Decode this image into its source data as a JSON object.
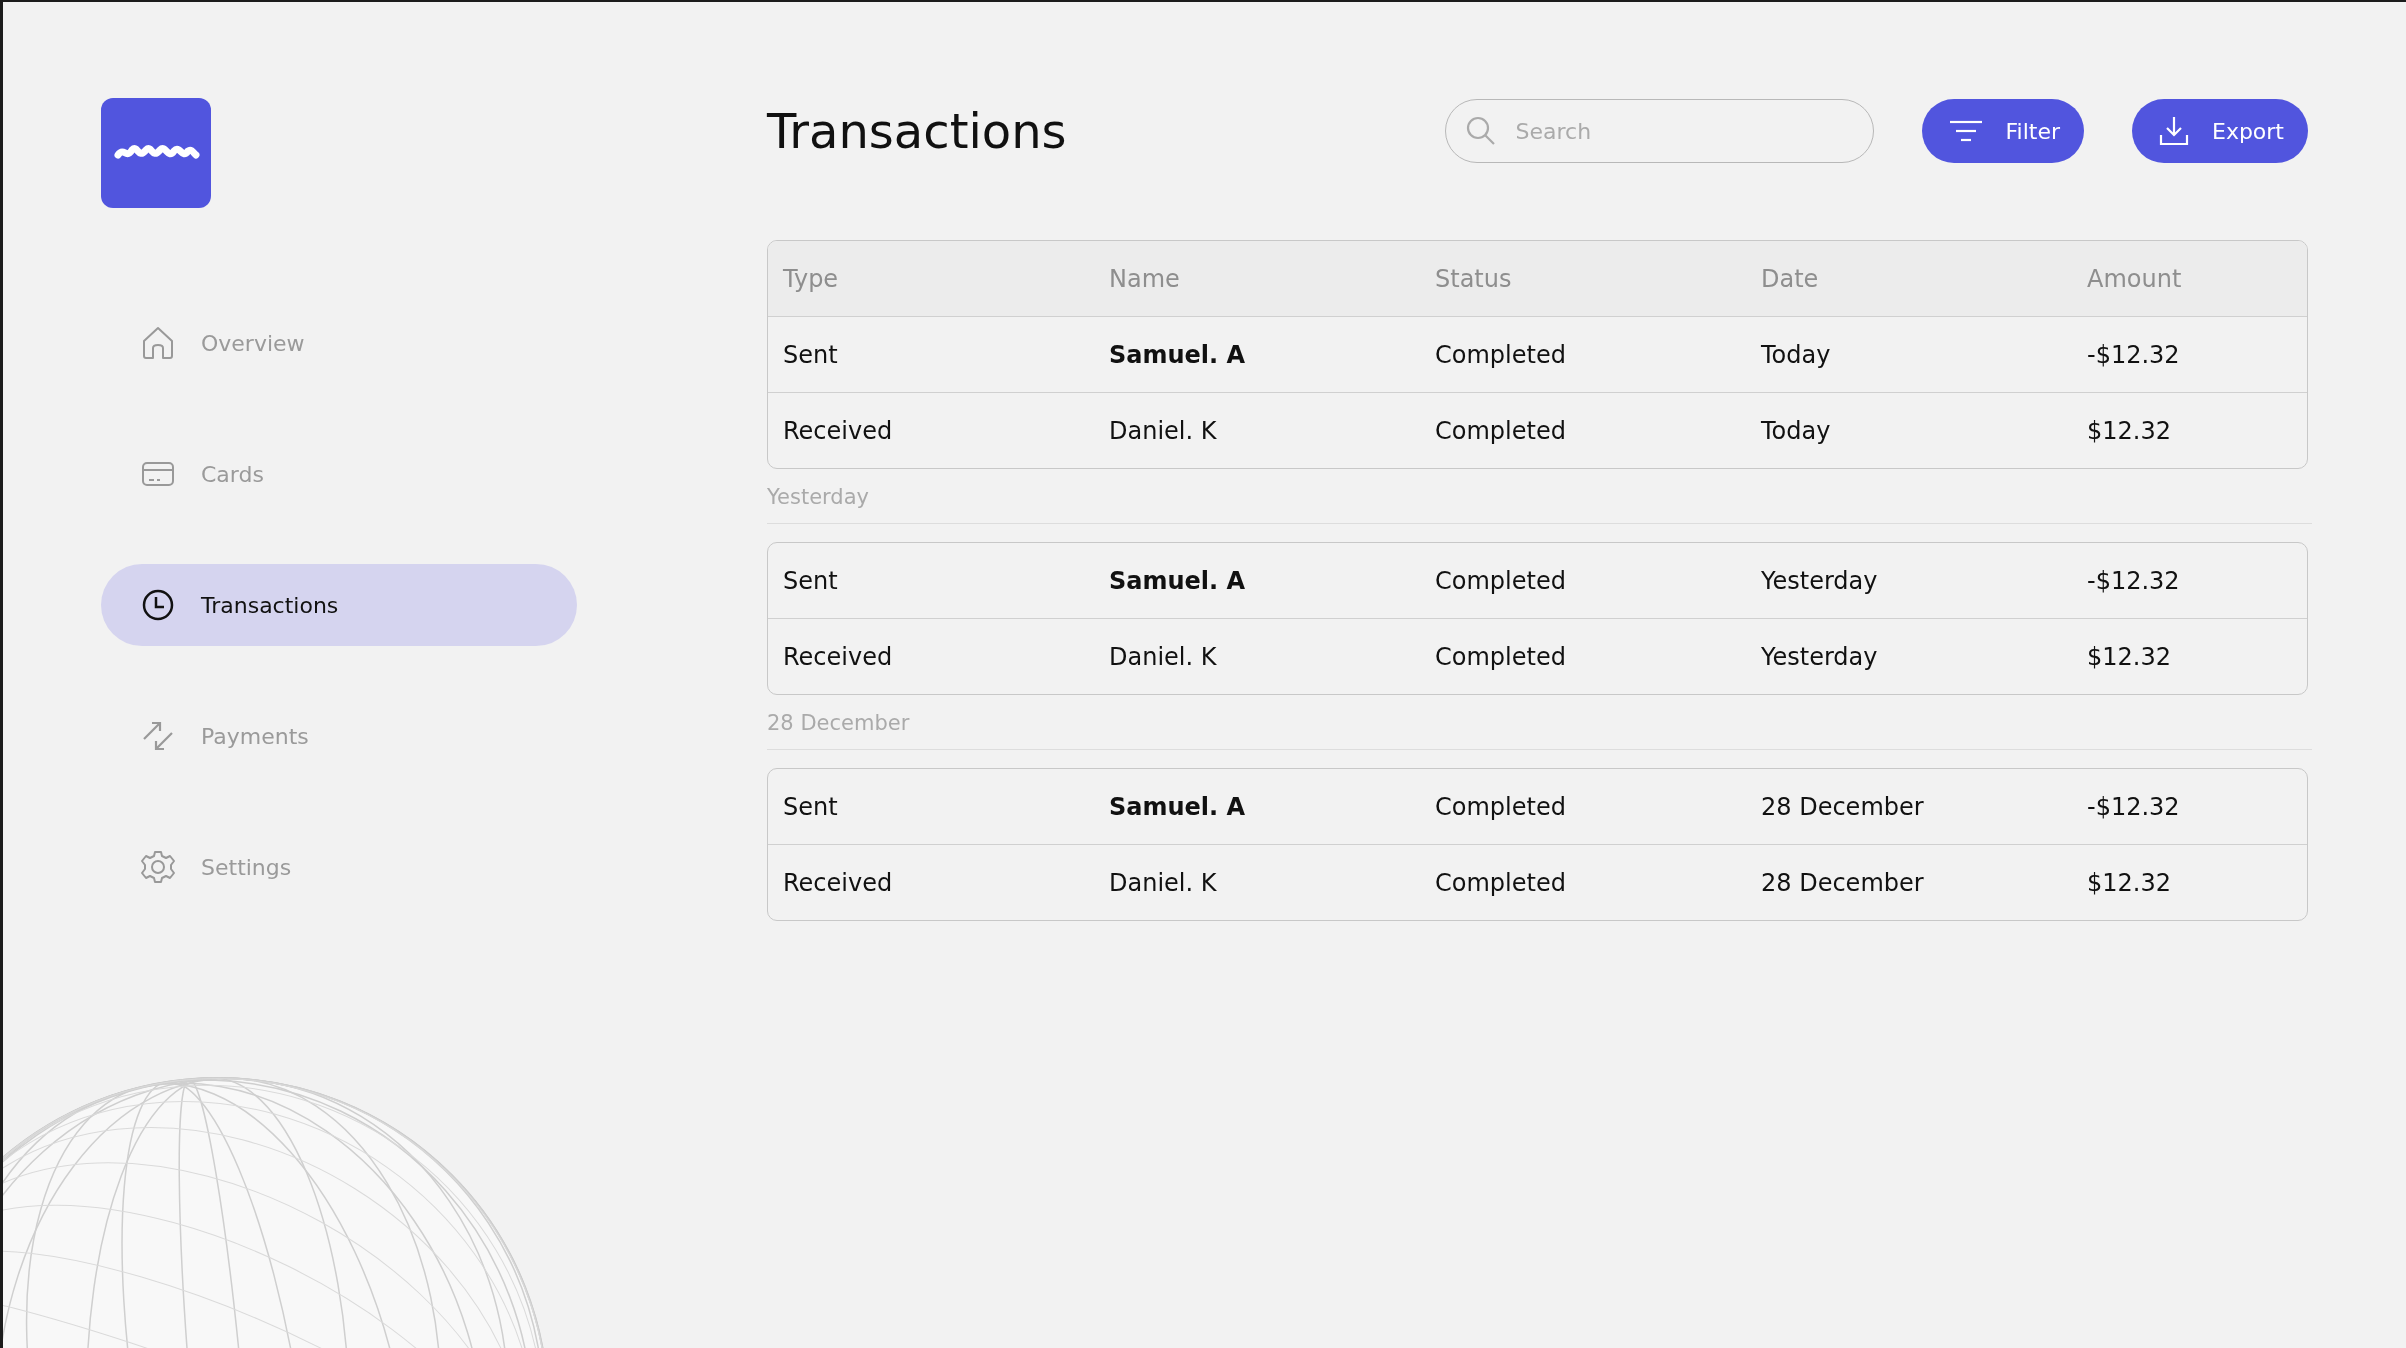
{
  "nav": [
    {
      "label": "Overview",
      "selected": false
    },
    {
      "label": "Cards",
      "selected": false
    },
    {
      "label": "Transactions",
      "selected": true
    },
    {
      "label": "Payments",
      "selected": false
    },
    {
      "label": "Settings",
      "selected": false
    }
  ],
  "header": {
    "title": "Transactions",
    "search": {
      "placeholder": "Search"
    },
    "buttons": [
      {
        "label": "Filter"
      },
      {
        "label": "Export"
      }
    ]
  },
  "table": {
    "columns": [
      "Type",
      "Name",
      "Status",
      "Date",
      "Amount"
    ],
    "groups": [
      {
        "rows": [
          {
            "type": "Sent",
            "name": "Samuel. A",
            "name_bold": true,
            "status": "Completed",
            "date": "Today",
            "amount": "-$12.32"
          },
          {
            "type": "Received",
            "name": "Daniel. K",
            "name_bold": false,
            "status": "Completed",
            "date": "Today",
            "amount": "$12.32"
          }
        ]
      },
      {
        "label": "Yesterday",
        "rows": [
          {
            "type": "Sent",
            "name": "Samuel. A",
            "name_bold": true,
            "status": "Completed",
            "date": "Yesterday",
            "amount": "-$12.32"
          },
          {
            "type": "Received",
            "name": "Daniel. K",
            "name_bold": false,
            "status": "Completed",
            "date": "Yesterday",
            "amount": "$12.32"
          }
        ]
      },
      {
        "label": "28 December",
        "rows": [
          {
            "type": "Sent",
            "name": "Samuel. A",
            "name_bold": true,
            "status": "Completed",
            "date": "28 December",
            "amount": "-$12.32"
          },
          {
            "type": "Received",
            "name": "Daniel. K",
            "name_bold": false,
            "status": "Completed",
            "date": "28 December",
            "amount": "$12.32"
          }
        ]
      }
    ]
  }
}
